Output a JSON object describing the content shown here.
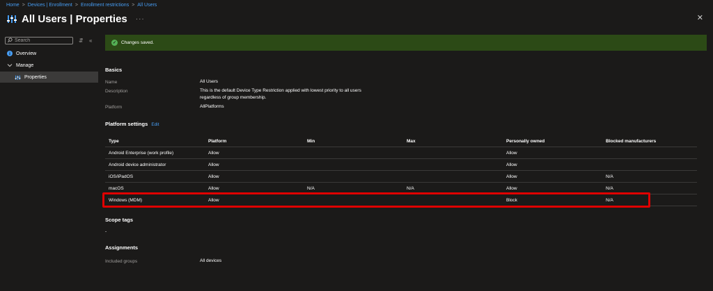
{
  "breadcrumb": [
    "Home",
    "Devices | Enrollment",
    "Enrollment restrictions",
    "All Users"
  ],
  "header": {
    "title": "All Users | Properties",
    "more": "···",
    "close": "✕"
  },
  "sidebar": {
    "search_placeholder": "Search",
    "items": [
      {
        "label": "Overview"
      },
      {
        "label": "Manage"
      },
      {
        "label": "Properties"
      }
    ]
  },
  "banner": {
    "text": "Changes saved."
  },
  "basics": {
    "heading": "Basics",
    "rows": [
      {
        "label": "Name",
        "value": "All Users"
      },
      {
        "label": "Description",
        "value": "This is the default Device Type Restriction applied with lowest priority to all users regardless of group membership."
      },
      {
        "label": "Platform",
        "value": "AllPlatforms"
      }
    ]
  },
  "platform_settings": {
    "heading": "Platform settings",
    "edit": "Edit",
    "columns": [
      "Type",
      "Platform",
      "Min",
      "Max",
      "Personally owned",
      "Blocked manufacturers"
    ],
    "rows": [
      [
        "Android Enterprise (work profile)",
        "Allow",
        "",
        "",
        "Allow",
        ""
      ],
      [
        "Android device administrator",
        "Allow",
        "",
        "",
        "Allow",
        ""
      ],
      [
        "iOS/iPadOS",
        "Allow",
        "",
        "",
        "Allow",
        "N/A"
      ],
      [
        "macOS",
        "Allow",
        "N/A",
        "N/A",
        "Allow",
        "N/A"
      ],
      [
        "Windows (MDM)",
        "Allow",
        "",
        "",
        "Block",
        "N/A"
      ]
    ]
  },
  "scope_tags": {
    "heading": "Scope tags",
    "value": "-"
  },
  "assignments": {
    "heading": "Assignments",
    "label": "Included groups",
    "value": "All devices"
  },
  "colors": {
    "accent": "#479ef5",
    "banner": "#2c4a16",
    "highlight": "#e00000",
    "success": "#54b054"
  }
}
